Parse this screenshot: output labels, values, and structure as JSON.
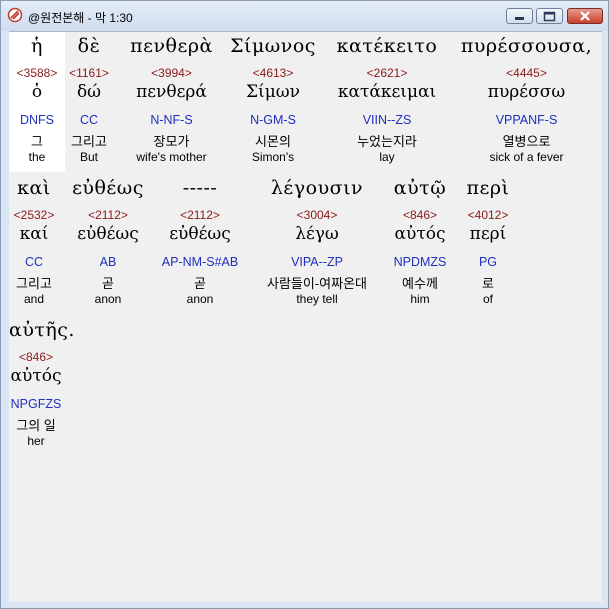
{
  "window": {
    "title": "@원전본해 - 막 1:30"
  },
  "words": [
    {
      "greek": "ἡ",
      "strong": "<3588>",
      "lemma": "ὁ",
      "parse": "DNFS",
      "korean": "그",
      "english": "the",
      "selected": true
    },
    {
      "greek": "δὲ",
      "strong": "<1161>",
      "lemma": "δώ",
      "parse": "CC",
      "korean": "그리고",
      "english": "But"
    },
    {
      "greek": "πενθερὰ",
      "strong": "<3994>",
      "lemma": "πενθερά",
      "parse": "N-NF-S",
      "korean": "장모가",
      "english": "wife's mother"
    },
    {
      "greek": "Σίμωνος",
      "strong": "<4613>",
      "lemma": "Σίμων",
      "parse": "N-GM-S",
      "korean": "시몬의",
      "english": "Simon's"
    },
    {
      "greek": "κατέκειτο",
      "strong": "<2621>",
      "lemma": "κατάκειμαι",
      "parse": "VIIN--ZS",
      "korean": "누었는지라",
      "english": "lay"
    },
    {
      "greek": "πυρέσσουσα,",
      "strong": "<4445>",
      "lemma": "πυρέσσω",
      "parse": "VPPANF-S",
      "korean": "열병으로",
      "english": "sick of a fever"
    },
    {
      "greek": "καὶ",
      "strong": "<2532>",
      "lemma": "καί",
      "parse": "CC",
      "korean": "그리고",
      "english": "and"
    },
    {
      "greek": "εὐθέως",
      "strong": "<2112>",
      "lemma": "εὐθέως",
      "parse": "AB",
      "korean": "곧",
      "english": "anon"
    },
    {
      "greek": "-----",
      "strong": "<2112>",
      "lemma": "εὐθέως",
      "parse": "AP-NM-S#AB",
      "korean": "곧",
      "english": "anon"
    },
    {
      "greek": "λέγουσιν",
      "strong": "<3004>",
      "lemma": "λέγω",
      "parse": "VIPA--ZP",
      "korean": "사람들이-여짜온대",
      "english": "they tell"
    },
    {
      "greek": "αὐτῷ",
      "strong": "<846>",
      "lemma": "αὐτός",
      "parse": "NPDMZS",
      "korean": "예수께",
      "english": "him"
    },
    {
      "greek": "περὶ",
      "strong": "<4012>",
      "lemma": "περί",
      "parse": "PG",
      "korean": "로",
      "english": "of"
    },
    {
      "greek": "αὐτῆς.",
      "strong": "<846>",
      "lemma": "αὐτός",
      "parse": "NPGFZS",
      "korean": "그의 일",
      "english": "her"
    }
  ]
}
